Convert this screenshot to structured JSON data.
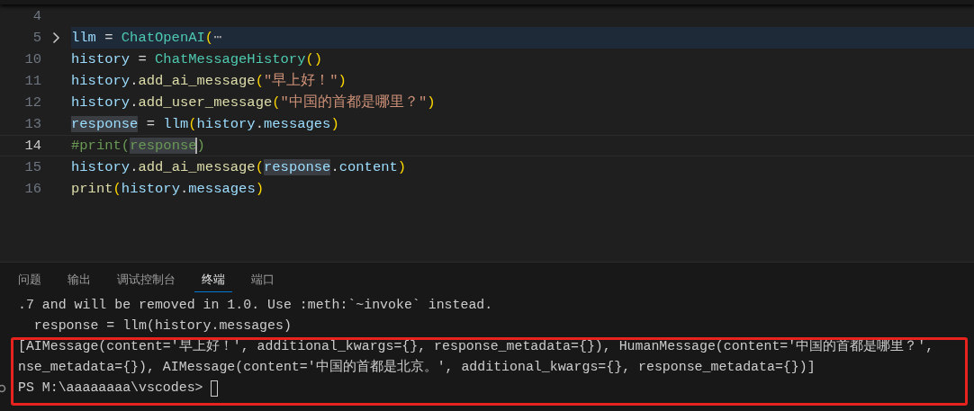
{
  "editor": {
    "lines": [
      {
        "number": "4",
        "current": false,
        "folded": false
      },
      {
        "number": "5",
        "current": false,
        "folded": true,
        "tokens": [
          {
            "text": "llm",
            "kind": "var",
            "highlighted": false,
            "caret": false
          },
          {
            "text": " = ",
            "kind": "op",
            "highlighted": false,
            "caret": false
          },
          {
            "text": "ChatOpenAI",
            "kind": "cls",
            "highlighted": false,
            "caret": false
          },
          {
            "text": "(",
            "kind": "paren",
            "highlighted": false,
            "caret": false
          },
          {
            "text": "⋯",
            "kind": "fold",
            "highlighted": false,
            "caret": false
          }
        ]
      },
      {
        "number": "10",
        "current": false,
        "folded": false,
        "tokens": [
          {
            "text": "history",
            "kind": "var",
            "highlighted": false,
            "caret": false
          },
          {
            "text": " = ",
            "kind": "op",
            "highlighted": false,
            "caret": false
          },
          {
            "text": "ChatMessageHistory",
            "kind": "cls",
            "highlighted": false,
            "caret": false
          },
          {
            "text": "()",
            "kind": "paren",
            "highlighted": false,
            "caret": false
          }
        ]
      },
      {
        "number": "11",
        "current": false,
        "folded": false,
        "tokens": [
          {
            "text": "history",
            "kind": "var",
            "highlighted": false,
            "caret": false
          },
          {
            "text": ".",
            "kind": "op",
            "highlighted": false,
            "caret": false
          },
          {
            "text": "add_ai_message",
            "kind": "func",
            "highlighted": false,
            "caret": false
          },
          {
            "text": "(",
            "kind": "paren",
            "highlighted": false,
            "caret": false
          },
          {
            "text": "\"早上好！\"",
            "kind": "str",
            "highlighted": false,
            "caret": false
          },
          {
            "text": ")",
            "kind": "paren",
            "highlighted": false,
            "caret": false
          }
        ]
      },
      {
        "number": "12",
        "current": false,
        "folded": false,
        "tokens": [
          {
            "text": "history",
            "kind": "var",
            "highlighted": false,
            "caret": false
          },
          {
            "text": ".",
            "kind": "op",
            "highlighted": false,
            "caret": false
          },
          {
            "text": "add_user_message",
            "kind": "func",
            "highlighted": false,
            "caret": false
          },
          {
            "text": "(",
            "kind": "paren",
            "highlighted": false,
            "caret": false
          },
          {
            "text": "\"中国的首都是哪里？\"",
            "kind": "str",
            "highlighted": false,
            "caret": false
          },
          {
            "text": ")",
            "kind": "paren",
            "highlighted": false,
            "caret": false
          }
        ]
      },
      {
        "number": "13",
        "current": false,
        "folded": false,
        "tokens": [
          {
            "text": "response",
            "kind": "var",
            "highlighted": true,
            "caret": false
          },
          {
            "text": " = ",
            "kind": "op",
            "highlighted": false,
            "caret": false
          },
          {
            "text": "llm",
            "kind": "var",
            "highlighted": false,
            "caret": false
          },
          {
            "text": "(",
            "kind": "paren",
            "highlighted": false,
            "caret": false
          },
          {
            "text": "history",
            "kind": "var",
            "highlighted": false,
            "caret": false
          },
          {
            "text": ".",
            "kind": "op",
            "highlighted": false,
            "caret": false
          },
          {
            "text": "messages",
            "kind": "var",
            "highlighted": false,
            "caret": false
          },
          {
            "text": ")",
            "kind": "paren",
            "highlighted": false,
            "caret": false
          }
        ]
      },
      {
        "number": "14",
        "current": true,
        "folded": false,
        "tokens": [
          {
            "text": "#print(",
            "kind": "comment",
            "highlighted": false,
            "caret": false
          },
          {
            "text": "response",
            "kind": "comment",
            "highlighted": true,
            "caret": true
          },
          {
            "text": ")",
            "kind": "comment",
            "highlighted": false,
            "caret": false
          }
        ]
      },
      {
        "number": "15",
        "current": false,
        "folded": false,
        "tokens": [
          {
            "text": "history",
            "kind": "var",
            "highlighted": false,
            "caret": false
          },
          {
            "text": ".",
            "kind": "op",
            "highlighted": false,
            "caret": false
          },
          {
            "text": "add_ai_message",
            "kind": "func",
            "highlighted": false,
            "caret": false
          },
          {
            "text": "(",
            "kind": "paren",
            "highlighted": false,
            "caret": false
          },
          {
            "text": "response",
            "kind": "var",
            "highlighted": true,
            "caret": false
          },
          {
            "text": ".",
            "kind": "op",
            "highlighted": false,
            "caret": false
          },
          {
            "text": "content",
            "kind": "var",
            "highlighted": false,
            "caret": false
          },
          {
            "text": ")",
            "kind": "paren",
            "highlighted": false,
            "caret": false
          }
        ]
      },
      {
        "number": "16",
        "current": false,
        "folded": false,
        "tokens": [
          {
            "text": "print",
            "kind": "func",
            "highlighted": false,
            "caret": false
          },
          {
            "text": "(",
            "kind": "paren",
            "highlighted": false,
            "caret": false
          },
          {
            "text": "history",
            "kind": "var",
            "highlighted": false,
            "caret": false
          },
          {
            "text": ".",
            "kind": "op",
            "highlighted": false,
            "caret": false
          },
          {
            "text": "messages",
            "kind": "var",
            "highlighted": false,
            "caret": false
          },
          {
            "text": ")",
            "kind": "paren",
            "highlighted": false,
            "caret": false
          }
        ]
      }
    ]
  },
  "panel": {
    "tabs": [
      {
        "label": "问题",
        "selected": false
      },
      {
        "label": "输出",
        "selected": false
      },
      {
        "label": "调试控制台",
        "selected": false
      },
      {
        "label": "终端",
        "selected": true
      },
      {
        "label": "端口",
        "selected": false
      }
    ],
    "terminal": {
      "lines": [
        ".7 and will be removed in 1.0. Use :meth:`~invoke` instead.",
        "  response = llm(history.messages)",
        "[AIMessage(content='早上好！', additional_kwargs={}, response_metadata={}), HumanMessage(content='中国的首都是哪里？',",
        "nse_metadata={}), AIMessage(content='中国的首都是北京。', additional_kwargs={}, response_metadata={})]"
      ],
      "prompt": {
        "text": "PS M:\\aaaaaaaa\\vscodes> ",
        "cursor": true
      }
    }
  }
}
